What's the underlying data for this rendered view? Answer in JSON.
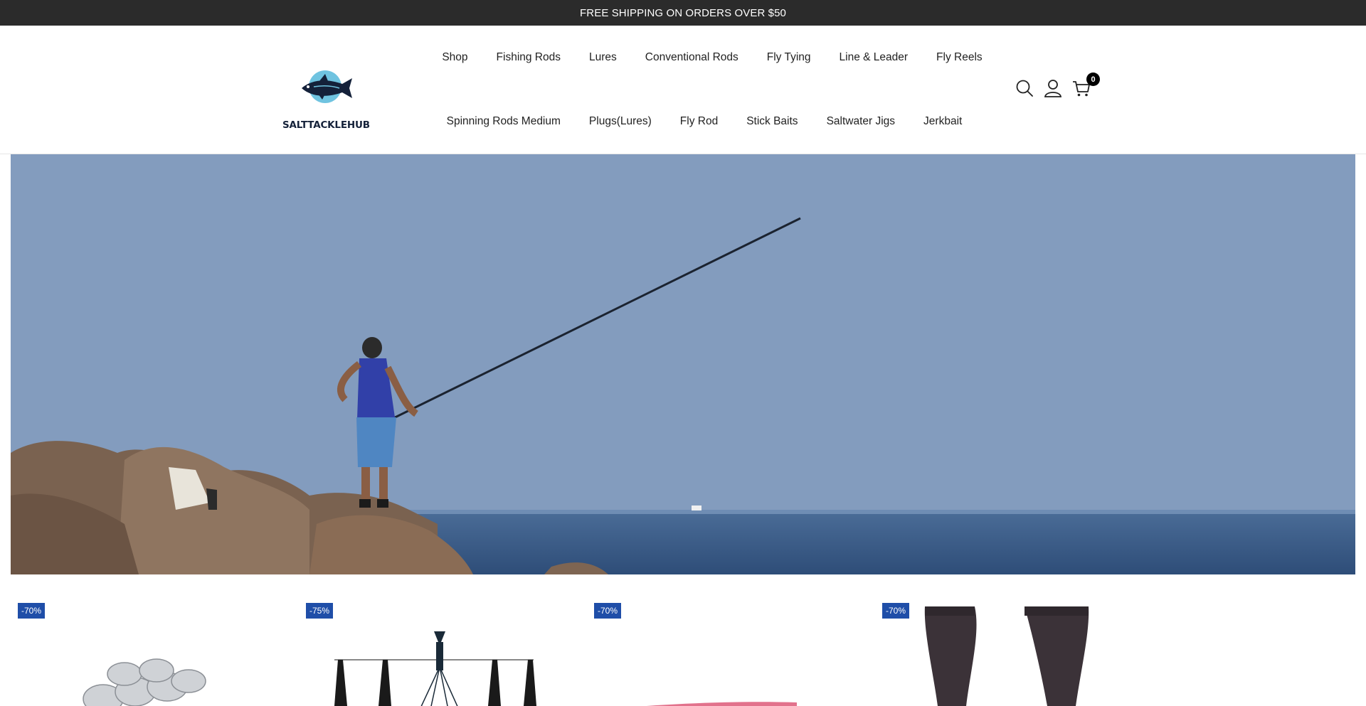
{
  "announcement": "FREE SHIPPING ON ORDERS OVER $50",
  "logo": {
    "text": "SALTTACKLEHUB"
  },
  "nav": {
    "row1": [
      "Shop",
      "Fishing Rods",
      "Lures",
      "Conventional Rods",
      "Fly Tying",
      "Line & Leader",
      "Fly Reels"
    ],
    "row2": [
      "Spinning Rods Medium",
      "Plugs(Lures)",
      "Fly Rod",
      "Stick Baits",
      "Saltwater Jigs",
      "Jerkbait"
    ]
  },
  "header_icons": {
    "search": "search-icon",
    "account": "user-icon",
    "cart": "cart-icon",
    "cart_count": "0"
  },
  "products": [
    {
      "badge": "-70%",
      "image": "magnets-product"
    },
    {
      "badge": "-75%",
      "image": "umbrella-rig-product"
    },
    {
      "badge": "-70%",
      "image": "pink-worm-product"
    },
    {
      "badge": "-70%",
      "image": "neoprene-socks-product"
    }
  ],
  "colors": {
    "badge": "#1f4ea8",
    "announcement_bg": "#2b2b2b"
  }
}
